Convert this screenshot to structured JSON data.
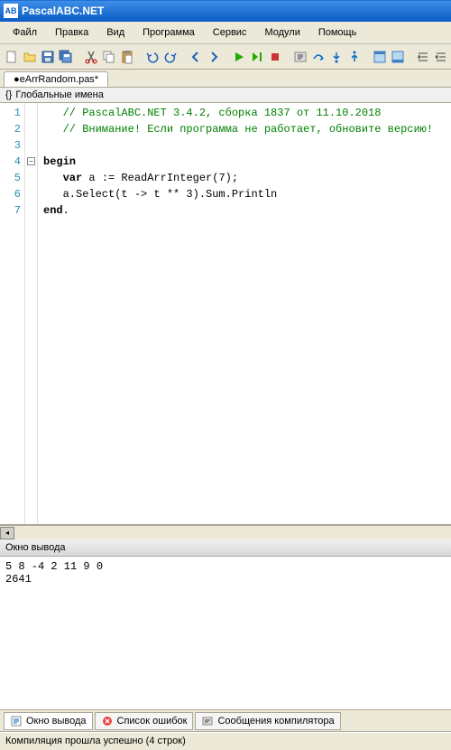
{
  "window": {
    "title": "PascalABC.NET"
  },
  "menu": {
    "file": "Файл",
    "edit": "Правка",
    "view": "Вид",
    "program": "Программа",
    "service": "Сервис",
    "modules": "Модули",
    "help": "Помощь"
  },
  "tabs": {
    "active": "eArrRandom.pas*",
    "dot": "●"
  },
  "globalnames": {
    "label": "Глобальные имена"
  },
  "code": {
    "lines": [
      "1",
      "2",
      "3",
      "4",
      "5",
      "6",
      "7"
    ],
    "l1": "   // PascalABC.NET 3.4.2, сборка 1837 от 11.10.2018",
    "l2": "   // Внимание! Если программа не работает, обновите версию!",
    "l3": "",
    "l4_kw": "begin",
    "l5a": "   ",
    "l5_kw": "var",
    "l5b": " a := ReadArrInteger(7);",
    "l6": "   a.Select(t -> t ** 3).Sum.Println",
    "l7_kw": "end",
    "l7b": "."
  },
  "output": {
    "title": "Окно вывода",
    "line1": "5 8 -4 2 11 9 0",
    "line2": "2641"
  },
  "bottom_tabs": {
    "output": "Окно вывода",
    "errors": "Список ошибок",
    "compiler": "Сообщения компилятора"
  },
  "status": {
    "text": "Компиляция прошла успешно (4 строк)"
  }
}
